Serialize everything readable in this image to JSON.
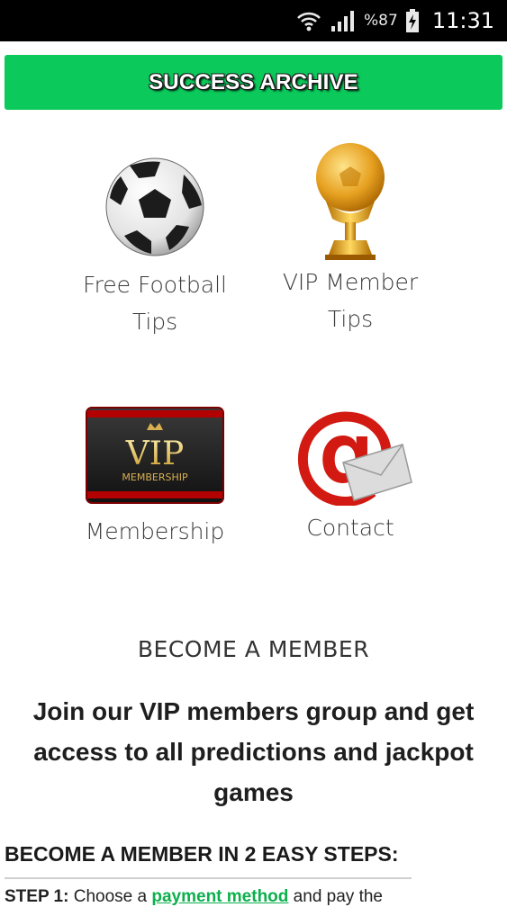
{
  "status_bar": {
    "battery_percent": "%87",
    "time": "11:31",
    "icons": [
      "wifi-icon",
      "signal-icon",
      "battery-charging-icon"
    ]
  },
  "archive_button": {
    "label": "SUCCESS ARCHIVE",
    "color": "#0bc95a"
  },
  "tiles": [
    {
      "label": "Free Football\nTips",
      "icon": "soccer-ball-icon"
    },
    {
      "label": "VIP Member\nTips",
      "icon": "trophy-icon"
    },
    {
      "label": "Membership",
      "icon": "vip-membership-card-icon"
    },
    {
      "label": "Contact",
      "icon": "email-at-icon"
    }
  ],
  "become_member": {
    "heading": "BECOME A MEMBER",
    "join_text": "Join our VIP members group and get access to all predictions and jackpot games"
  },
  "steps": {
    "heading": "BECOME A MEMBER IN 2 EASY STEPS:",
    "step1_prefix": "STEP 1:",
    "step1_text": " Choose a ",
    "step1_link": "payment method",
    "step1_suffix": " and pay the"
  }
}
